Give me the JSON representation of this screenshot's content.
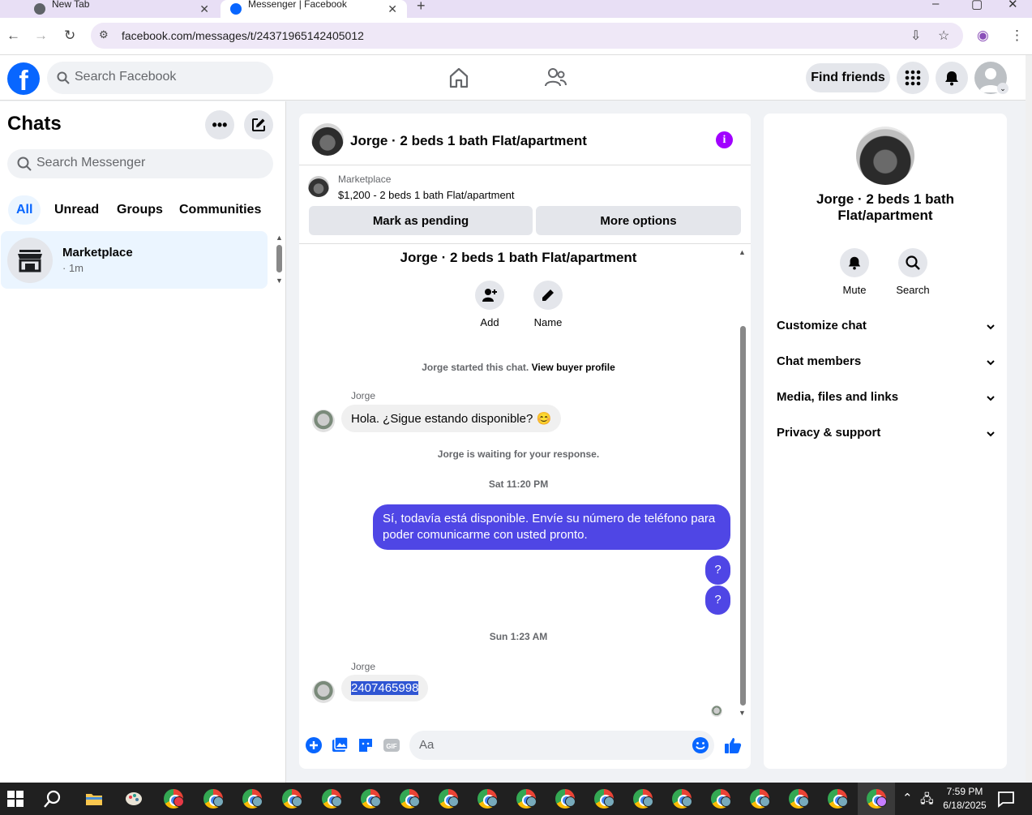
{
  "browser": {
    "tabs": [
      {
        "title": "New Tab",
        "active": false
      },
      {
        "title": "Messenger | Facebook",
        "active": true
      }
    ],
    "url": "facebook.com/messages/t/24371965142405012"
  },
  "fb_nav": {
    "search_placeholder": "Search Facebook",
    "find_friends": "Find friends"
  },
  "sidebar": {
    "title": "Chats",
    "search_placeholder": "Search Messenger",
    "filters": [
      "All",
      "Unread",
      "Groups",
      "Communities"
    ],
    "active_filter": "All",
    "chats": [
      {
        "name": "Marketplace",
        "time": "· 1m"
      }
    ]
  },
  "conversation": {
    "title": "Jorge · 2 beds 1 bath Flat/apartment",
    "marketplace_label": "Marketplace",
    "listing": "$1,200 - 2 beds 1 bath Flat/apartment",
    "mark_pending": "Mark as pending",
    "more_options": "More options",
    "thread_title": "Jorge · 2 beds 1 bath Flat/apartment",
    "actions": [
      {
        "label": "Add",
        "icon": "add-person-icon"
      },
      {
        "label": "Name",
        "icon": "pencil-icon"
      }
    ],
    "started_prefix": "Jorge started this chat.",
    "view_buyer_profile": "View buyer profile",
    "messages": [
      {
        "sender": "Jorge",
        "text": "Hola. ¿Sigue estando disponible? 😊",
        "direction": "in"
      },
      {
        "system": "Jorge is waiting for your response."
      },
      {
        "timestamp": "Sat 11:20 PM"
      },
      {
        "text": "Sí, todavía está disponible. Envíe su número de teléfono para poder comunicarme con usted pronto.",
        "direction": "out"
      },
      {
        "text": "?",
        "direction": "out"
      },
      {
        "text": "?",
        "direction": "out"
      },
      {
        "timestamp": "Sun 1:23 AM"
      },
      {
        "sender": "Jorge",
        "text": "2407465998",
        "direction": "in",
        "selected": true
      }
    ],
    "composer_placeholder": "Aa"
  },
  "details": {
    "title": "Jorge · 2 beds 1 bath Flat/apartment",
    "actions": [
      {
        "label": "Mute",
        "icon": "bell-icon"
      },
      {
        "label": "Search",
        "icon": "search-icon"
      }
    ],
    "sections": [
      "Customize chat",
      "Chat members",
      "Media, files and links",
      "Privacy & support"
    ]
  },
  "taskbar": {
    "time": "7:59 PM",
    "date": "6/18/2025"
  },
  "colors": {
    "fb_blue": "#0866ff",
    "outgoing_bubble": "#4f46e5",
    "info_purple": "#a100ff"
  }
}
